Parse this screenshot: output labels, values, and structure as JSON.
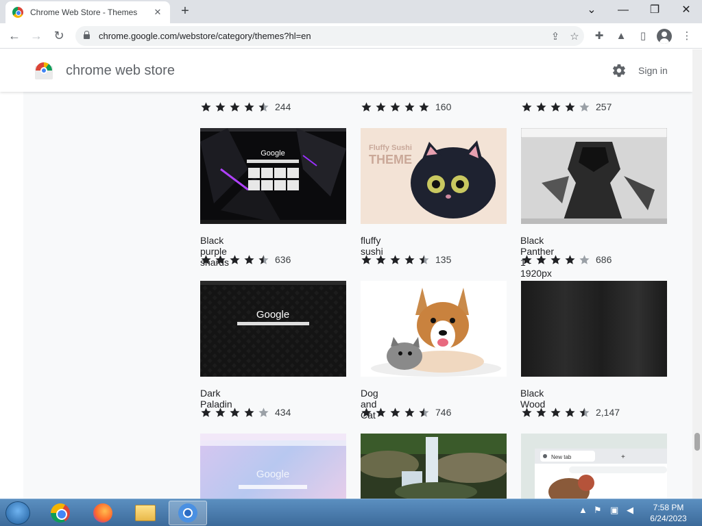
{
  "browser": {
    "tab_title": "Chrome Web Store - Themes",
    "close_tab": "✕",
    "new_tab": "+",
    "url": "chrome.google.com/webstore/category/themes?hl=en",
    "win_controls": [
      "⌄",
      "—",
      "❐",
      "✕"
    ]
  },
  "store": {
    "name": "chrome web store",
    "signin": "Sign in"
  },
  "items": [
    {
      "name": "",
      "rating": 4.5,
      "count": "244"
    },
    {
      "name": "",
      "rating": 5,
      "count": "160"
    },
    {
      "name": "",
      "rating": 4,
      "count": "257"
    },
    {
      "name": "Black purple shards",
      "rating": 4.5,
      "count": "636"
    },
    {
      "name": "fluffy sushi",
      "rating": 4.5,
      "count": "135"
    },
    {
      "name": "Black Panther 1 - 1920px",
      "rating": 4,
      "count": "686"
    },
    {
      "name": "Dark Paladin",
      "rating": 4,
      "count": "434"
    },
    {
      "name": "Dog and Cat",
      "rating": 4.5,
      "count": "746"
    },
    {
      "name": "Black Wood",
      "rating": 4.5,
      "count": "2,147"
    }
  ],
  "thumb_text": {
    "google": "Google",
    "fluffy_line1": "Fluffy Sushi",
    "fluffy_line2": "THEME",
    "new_tab": "New tab"
  },
  "taskbar": {
    "time": "7:58 PM",
    "date": "6/24/2023"
  },
  "colors": {
    "star": "#202124",
    "star_empty": "#9aa0a6",
    "accent": "#1a73e8"
  }
}
